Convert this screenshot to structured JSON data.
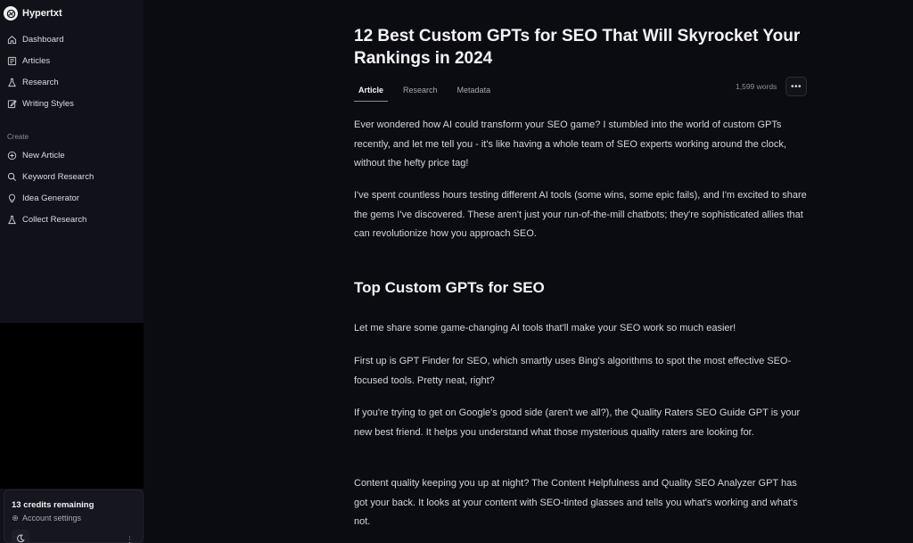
{
  "app": {
    "name": "Hypertxt"
  },
  "sidebar": {
    "main_items": [
      {
        "label": "Dashboard",
        "icon": "home-icon"
      },
      {
        "label": "Articles",
        "icon": "articles-icon"
      },
      {
        "label": "Research",
        "icon": "flask-icon"
      },
      {
        "label": "Writing Styles",
        "icon": "edit-icon"
      }
    ],
    "create_label": "Create",
    "create_items": [
      {
        "label": "New Article",
        "icon": "plus-circle-icon"
      },
      {
        "label": "Keyword Research",
        "icon": "search-icon"
      },
      {
        "label": "Idea Generator",
        "icon": "lightbulb-icon"
      },
      {
        "label": "Collect Research",
        "icon": "flask-icon"
      }
    ],
    "credits": "13 credits remaining",
    "account_settings": "Account settings"
  },
  "article": {
    "title": "12 Best Custom GPTs for SEO That Will Skyrocket Your Rankings in 2024",
    "tabs": [
      "Article",
      "Research",
      "Metadata"
    ],
    "active_tab": "Article",
    "word_count": "1,599 words",
    "more_label": "•••",
    "paragraphs": [
      "Ever wondered how AI could transform your SEO game? I stumbled into the world of custom GPTs recently, and let me tell you - it's like having a whole team of SEO experts working around the clock, without the hefty price tag!",
      "I've spent countless hours testing different AI tools (some wins, some epic fails), and I'm excited to share the gems I've discovered. These aren't just your run-of-the-mill chatbots; they're sophisticated allies that can revolutionize how you approach SEO."
    ],
    "section_heading": "Top Custom GPTs for SEO",
    "section_paragraphs": [
      "Let me share some game-changing AI tools that'll make your SEO work so much easier!",
      "First up is GPT Finder for SEO, which smartly uses Bing's algorithms to spot the most effective SEO-focused tools. Pretty neat, right?",
      "If you're trying to get on Google's good side (aren't we all?), the Quality Raters SEO Guide GPT is your new best friend. It helps you understand what those mysterious quality raters are looking for.",
      "Content quality keeping you up at night? The Content Helpfulness and Quality SEO Analyzer GPT has got your back. It looks at your content with SEO-tinted glasses and tells you what's working and what's not."
    ]
  }
}
